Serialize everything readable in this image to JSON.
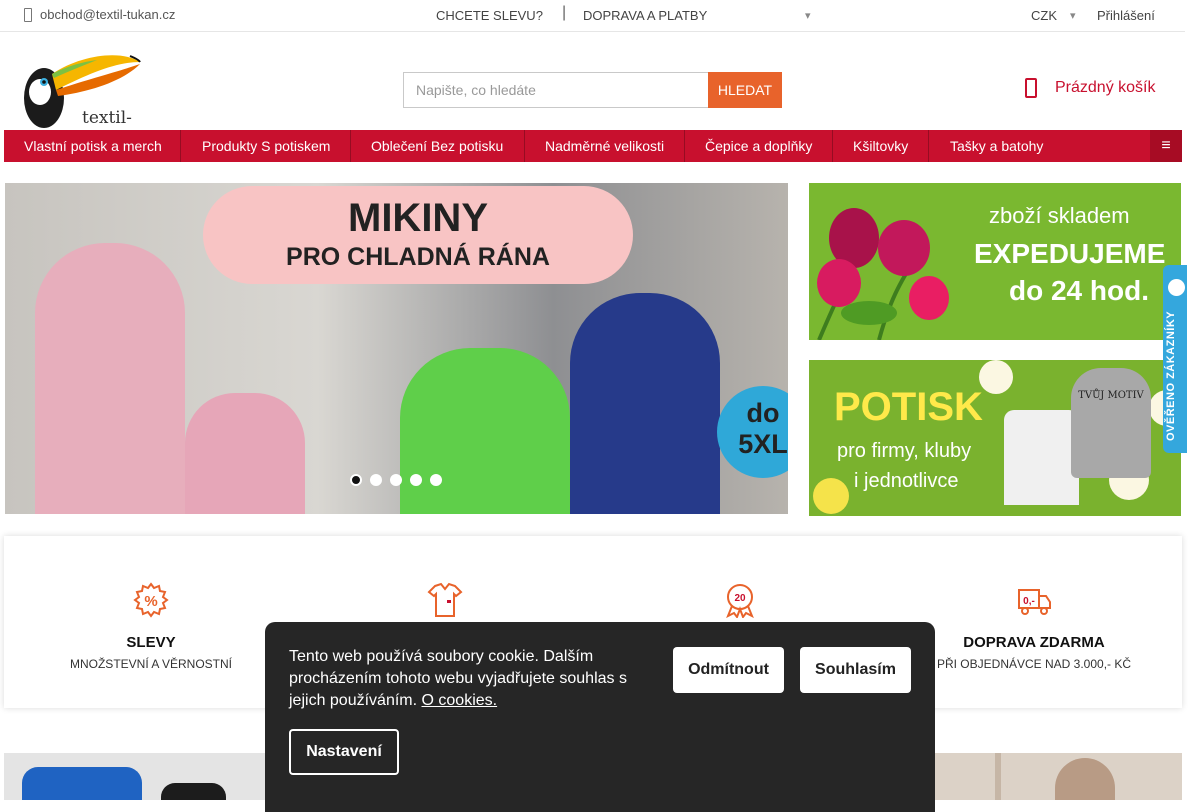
{
  "topbar": {
    "email": "obchod@textil-tukan.cz",
    "link_discount": "CHCETE SLEVU?",
    "separator": "|",
    "link_shipping": "DOPRAVA A PLATBY",
    "currency": "CZK",
    "login": "Přihlášení"
  },
  "header": {
    "brand": "textil-tukan.cz",
    "search_placeholder": "Napište, co hledáte",
    "search_button": "HLEDAT",
    "cart_label": "Prázdný košík"
  },
  "nav": {
    "items": [
      "Vlastní potisk a merch",
      "Produkty S potiskem",
      "Oblečení Bez potisku",
      "Nadměrné velikosti",
      "Čepice a doplňky",
      "Kšiltovky",
      "Tašky a batohy"
    ]
  },
  "slider": {
    "title": "MIKINY",
    "subtitle": "PRO CHLADNÁ RÁNA",
    "badge_line1": "do",
    "badge_line2": "5XL",
    "slide_count": 5,
    "active_slide": 1
  },
  "side_banners": {
    "stock": {
      "line1": "zboží skladem",
      "line2": "EXPEDUJEME",
      "line3": "do 24 hod."
    },
    "print": {
      "line1": "POTISK",
      "line2": "pro firmy, kluby",
      "line3": "i jednotlivce",
      "motif": "TVŮJ MOTIV"
    }
  },
  "trust_badge": {
    "label": "OVĚŘENO ZÁKAZNÍKY"
  },
  "benefits": [
    {
      "icon": "percent-icon",
      "title": "SLEVY",
      "subtitle": "MNOŽSTEVNÍ A VĚRNOSTNÍ"
    },
    {
      "icon": "shirt-icon",
      "title": "",
      "subtitle": ""
    },
    {
      "icon": "award-20-icon",
      "title": "",
      "subtitle": ""
    },
    {
      "icon": "truck-icon",
      "title": "DOPRAVA ZDARMA",
      "subtitle": "PŘI OBJEDNÁVCE NAD 3.000,- KČ"
    }
  ],
  "cookie": {
    "text": "Tento web používá soubory cookie. Dalším procházením tohoto webu vyjadřujete souhlas s jejich používáním.",
    "link": "O cookies.",
    "decline": "Odmítnout",
    "accept": "Souhlasím",
    "settings": "Nastavení"
  },
  "colors": {
    "brand_red": "#c8102e",
    "search_orange": "#e8632b",
    "banner_green": "#7ab830",
    "trust_blue": "#34a7dd"
  }
}
